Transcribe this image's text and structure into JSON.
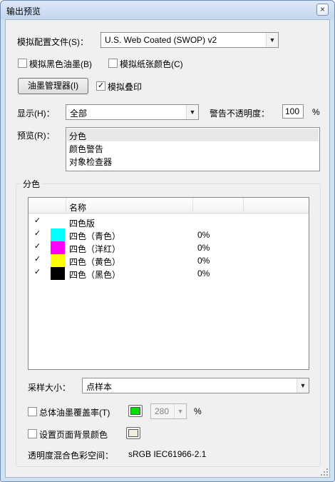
{
  "window": {
    "title": "输出预览",
    "close_glyph": "×"
  },
  "profile": {
    "label": "模拟配置文件(S)：",
    "value": "U.S. Web Coated (SWOP) v2"
  },
  "options": {
    "black_ink": {
      "label": "模拟黑色油墨(B)",
      "checked": false
    },
    "paper_color": {
      "label": "模拟纸张颜色(C)",
      "checked": false
    },
    "ink_manager_button": "油墨管理器(I)",
    "overprint": {
      "label": "模拟叠印",
      "checked": true,
      "mark": "✓"
    }
  },
  "display": {
    "label": "显示(H)：",
    "value": "全部",
    "warning_label": "警告不透明度：",
    "warning_value": "100",
    "warning_unit": "%"
  },
  "preview": {
    "label": "预览(R)：",
    "items": [
      "分色",
      "颜色警告",
      "对象检查器"
    ],
    "selected_index": 0
  },
  "separations": {
    "group_title": "分色",
    "columns": [
      "名称",
      "",
      ""
    ],
    "rows": [
      {
        "name": "四色版",
        "value": "",
        "color": "",
        "checked": true
      },
      {
        "name": "四色（青色）",
        "value": "0%",
        "color": "#00ffff",
        "checked": true
      },
      {
        "name": "四色（洋红）",
        "value": "0%",
        "color": "#ff00ff",
        "checked": true
      },
      {
        "name": "四色（黄色）",
        "value": "0%",
        "color": "#ffff00",
        "checked": true
      },
      {
        "name": "四色（黑色）",
        "value": "0%",
        "color": "#000000",
        "checked": true
      }
    ],
    "sample_label": "采样大小：",
    "sample_value": "点样本",
    "total_ink": {
      "label": "总体油墨覆盖率(T)",
      "checked": false,
      "color": "#00e000",
      "value": "280",
      "unit": "%"
    },
    "page_bg": {
      "label": "设置页面背景颜色",
      "checked": false,
      "color": "#f2f0dc"
    },
    "blend_label": "透明度混合色彩空间：",
    "blend_value": "sRGB IEC61966-2.1"
  },
  "colors": {
    "title_bar": "#c4d7ee",
    "dialog_bg": "#f0f0f0",
    "selected_row": "#e8e8e8"
  },
  "icons": [
    "close-icon",
    "dropdown-arrow-icon",
    "checkmark-icon",
    "resize-grip-icon"
  ]
}
